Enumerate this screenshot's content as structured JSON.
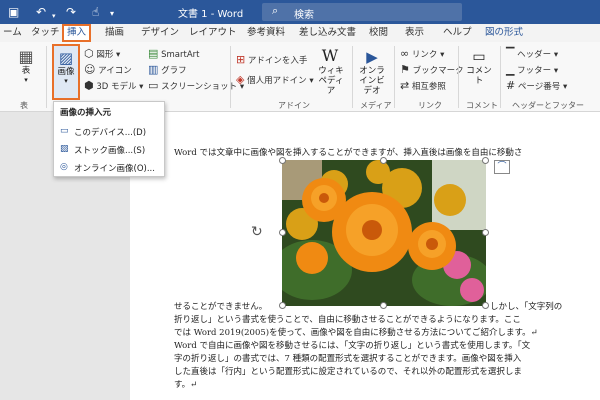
{
  "titlebar": {
    "doc_title": "文書 1 - Word",
    "search_placeholder": "検索",
    "icons": [
      "save-icon",
      "undo-icon",
      "redo-icon",
      "touch-mode-icon"
    ]
  },
  "tabs": [
    "ーム",
    "タッチ",
    "挿入",
    "描画",
    "デザイン",
    "レイアウト",
    "参考資料",
    "差し込み文書",
    "校閲",
    "表示",
    "ヘルプ",
    "図の形式"
  ],
  "ribbon": {
    "table_label": "表",
    "table_group": "表",
    "image_label": "画像",
    "shapes": "図形",
    "icons": "アイコン",
    "model3d": "3D モデル",
    "smartart": "SmartArt",
    "chart": "グラフ",
    "screenshot": "スクリーンショット",
    "get_addins": "アドインを入手",
    "my_addins": "個人用アドイン",
    "wikipedia": "ウィキペディア",
    "addins_group": "アドイン",
    "online_video": "オンラインビデオ",
    "media_group": "メディア",
    "link": "リンク",
    "bookmark": "ブックマーク",
    "cross_ref": "相互参照",
    "links_group": "リンク",
    "comment": "コメント",
    "comment_group": "コメント",
    "header": "ヘッダー",
    "footer": "フッター",
    "page_number": "ページ番号",
    "hf_group": "ヘッダーとフッター"
  },
  "dropdown": {
    "heading": "画像の挿入元",
    "items": [
      "このデバイス...(D)",
      "ストック画像...(S)",
      "オンライン画像(O)..."
    ]
  },
  "document": {
    "line1": "Word では文章中に画像や図を挿入することができますが、挿入直後は画像を自由に移動さ",
    "line2_left": "せることができません。",
    "line2_right": "しかし、「文字列の",
    "line3": "折り返し」という書式を使うことで、自由に移動させることができるようになります。ここ",
    "line4": "では Word 2019(2005)を使って、画像や図を自由に移動させる方法についてご紹介します。↵",
    "line5": "Word で自由に画像や図を移動させるには、「文字の折り返し」という書式を使用します。「文",
    "line6": "字の折り返し」の書式では、7 種類の配置形式を選択することができます。画像や図を挿入",
    "line7": "した直後は「行内」という配置形式に設定されているので、それ以外の配置形式を選択しま",
    "line8": "す。↵"
  },
  "colors": {
    "titlebar": "#2b579a",
    "accent_border": "#e8702a",
    "marigold": "#f08a12",
    "foliage": "#3f6d2a"
  }
}
